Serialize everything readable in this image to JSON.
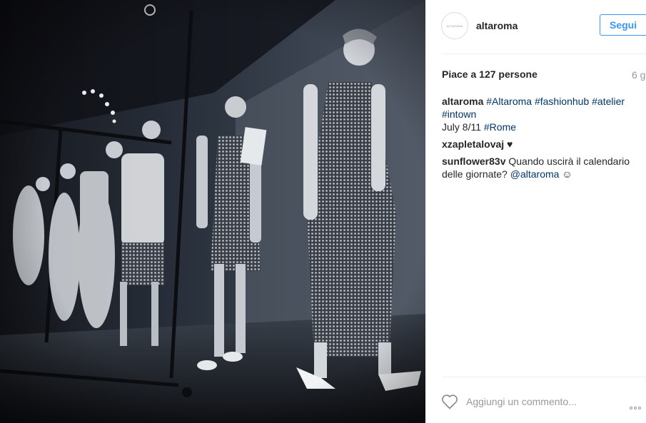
{
  "post": {
    "account": {
      "avatar_text": "ALTAROMA",
      "username": "altaroma",
      "follow_label": "Segui"
    },
    "likes_text": "Piace a 127 persone",
    "time_ago": "6 g",
    "caption": {
      "user": "altaroma",
      "hashtags": "#Altaroma #fashionhub #atelier #intown",
      "date_text": "July 8/11",
      "date_tag": "#Rome"
    },
    "comments": [
      {
        "user": "xzapletalovaj",
        "text": "♥"
      },
      {
        "user": "sunflower83v",
        "text": "Quando uscirà il calendario delle giornate?",
        "mention": "@altaroma",
        "emoji": "☺"
      }
    ],
    "add_comment_placeholder": "Aggiungi un commento...",
    "icons": {
      "like": "heart-icon",
      "options": "more-options-icon"
    }
  },
  "colors": {
    "link": "#003569",
    "follow": "#3897f0",
    "muted": "#999999",
    "text": "#262626"
  }
}
